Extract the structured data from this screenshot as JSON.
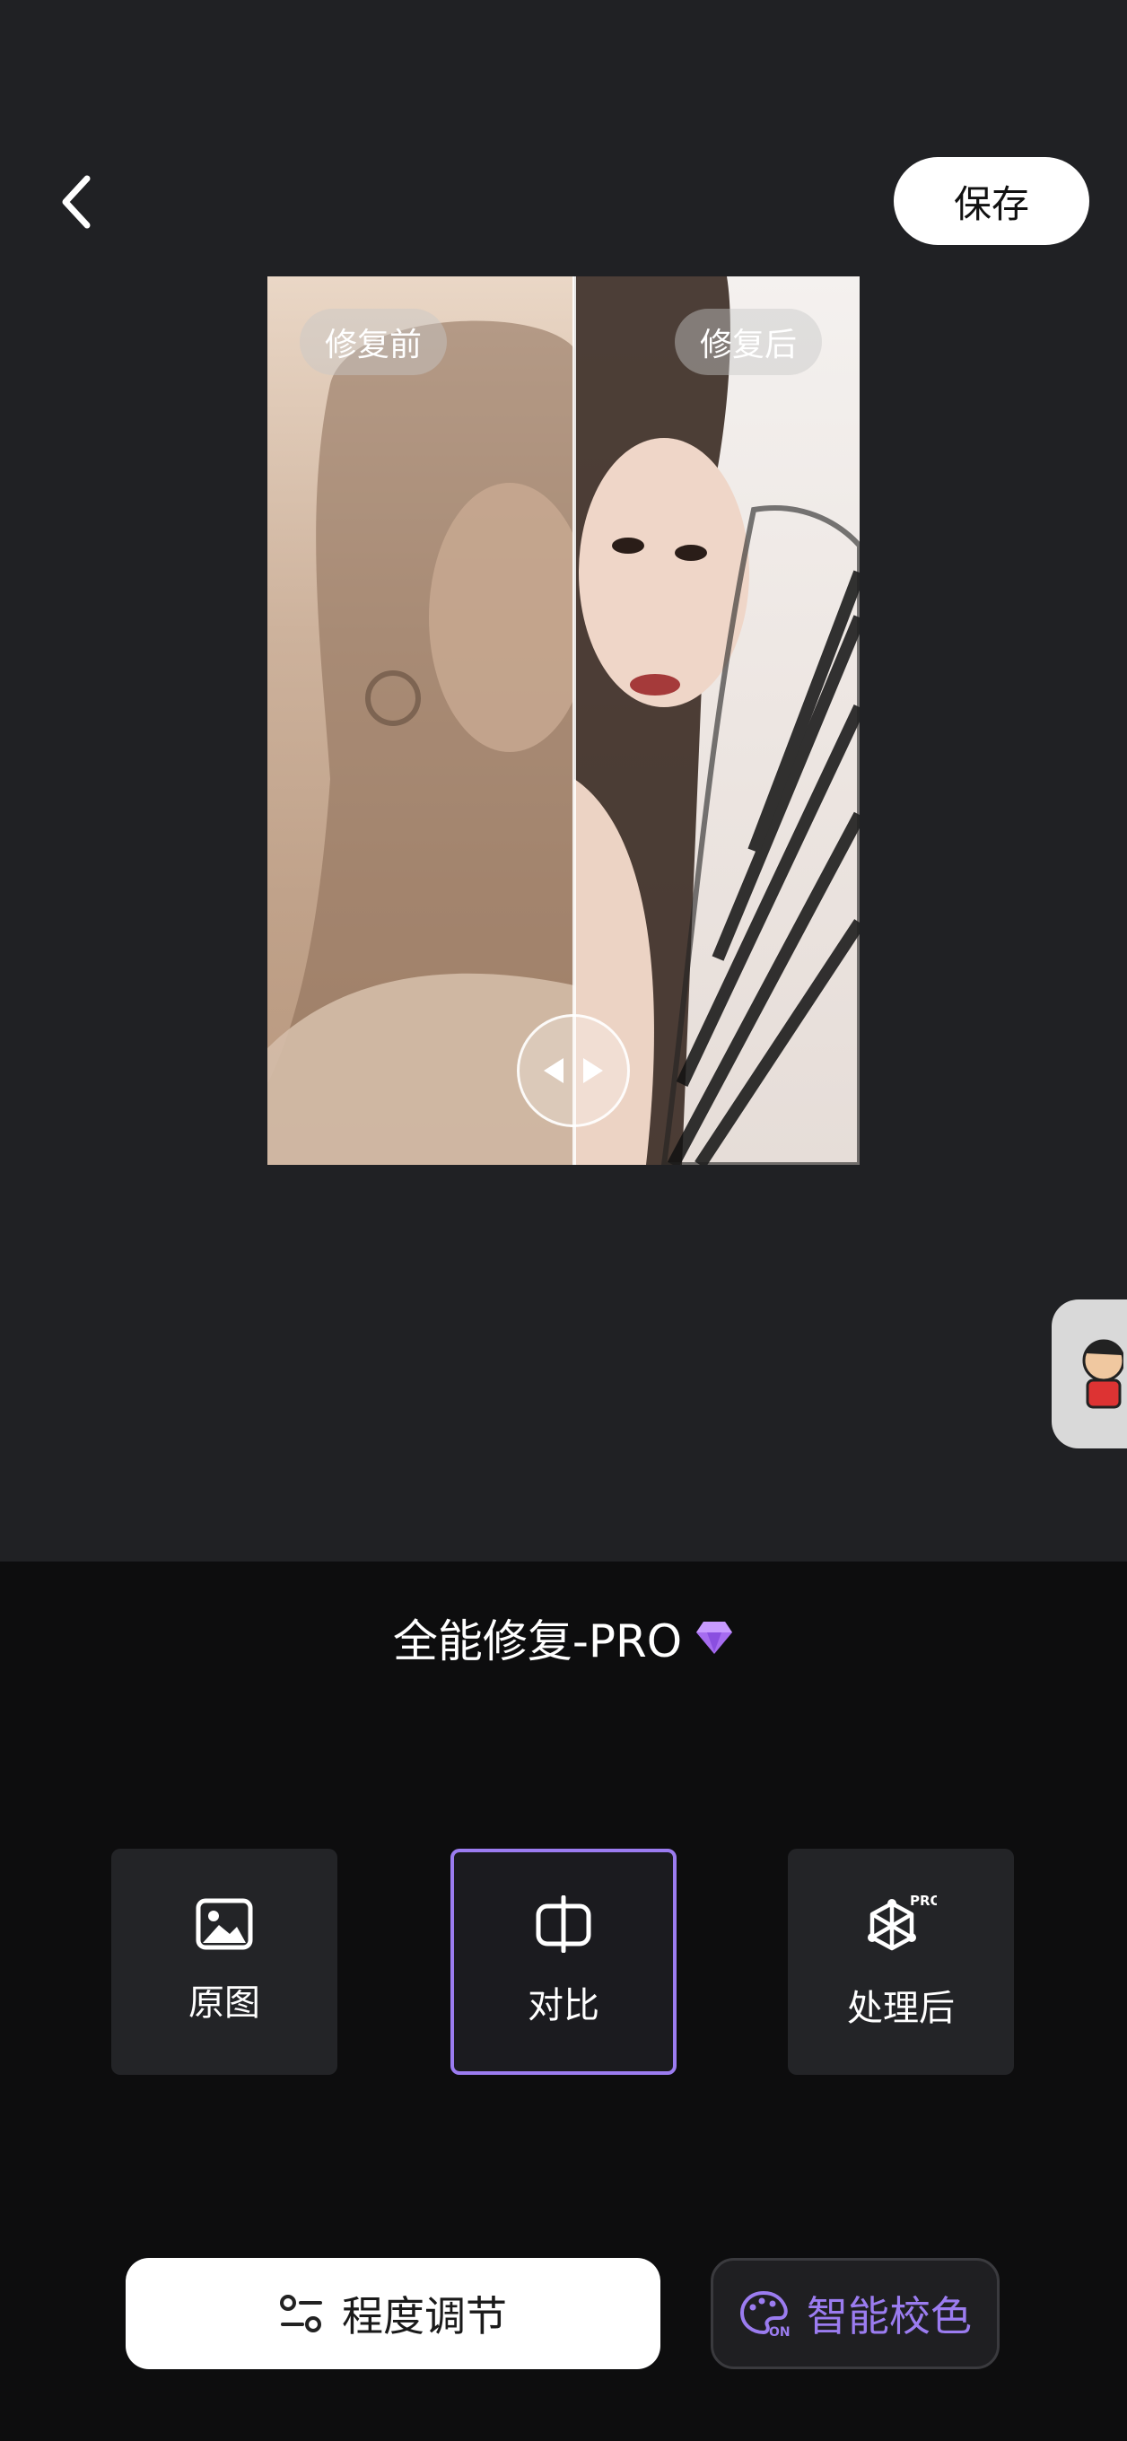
{
  "header": {
    "back_icon": "chevron-left-icon",
    "save_label": "保存"
  },
  "preview": {
    "before_label": "修复前",
    "after_label": "修复后",
    "handle_icons": [
      "arrow-left-icon",
      "arrow-right-icon"
    ]
  },
  "mode": {
    "title": "全能修复-PRO",
    "badge_icon": "diamond-icon",
    "badge_color": "#a66cf0"
  },
  "view_options": [
    {
      "label": "原图",
      "icon": "image-icon",
      "selected": false
    },
    {
      "label": "对比",
      "icon": "compare-icon",
      "selected": true
    },
    {
      "label": "处理后",
      "icon": "pro-processed-icon",
      "badge": "PRO",
      "selected": false
    }
  ],
  "actions": {
    "adjust_label": "程度调节",
    "adjust_icon": "sliders-icon",
    "color_label": "智能校色",
    "color_icon": "palette-on-icon",
    "color_badge": "ON",
    "accent_color": "#9b7cf0"
  }
}
